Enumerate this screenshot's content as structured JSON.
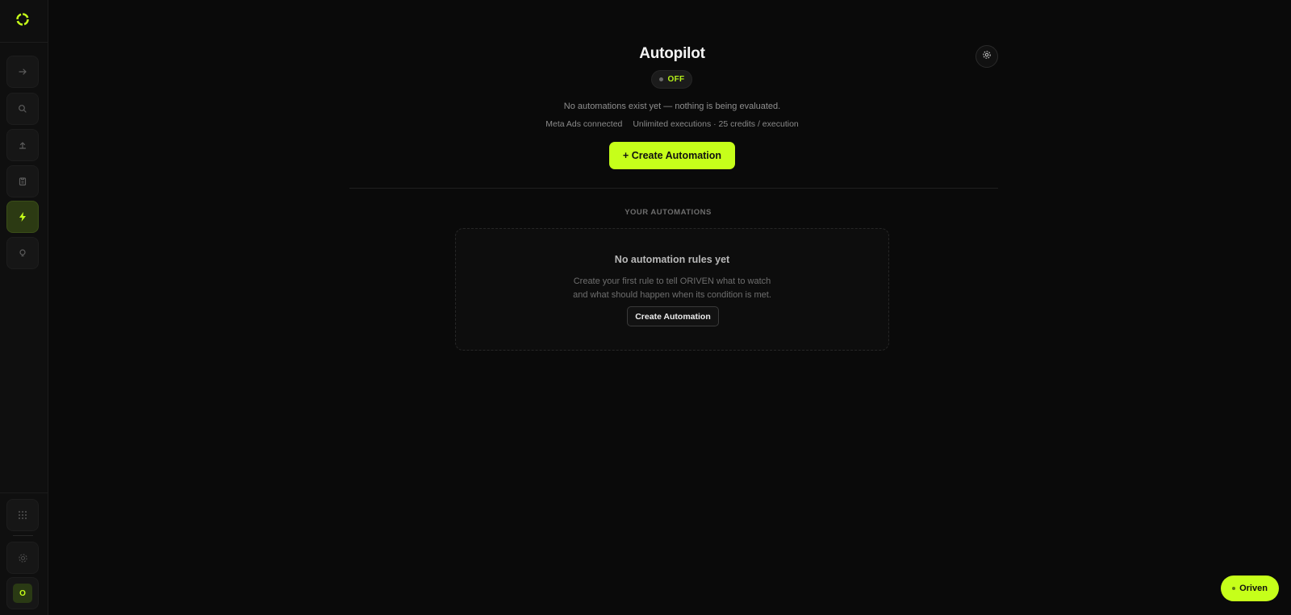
{
  "page": {
    "title": "Autopilot",
    "status": "OFF",
    "subtitle": "No automations exist yet — nothing is being evaluated.",
    "meta": {
      "connection": "Meta Ads connected",
      "executions": "Unlimited executions · 25 credits / execution"
    },
    "primary_action": "+ Create Automation",
    "section_label": "YOUR AUTOMATIONS",
    "empty_state": {
      "title": "No automation rules yet",
      "line1": "Create your first rule to tell ORIVEN what to watch",
      "line2": "and what should happen when its condition is met.",
      "action": "Create Automation"
    }
  },
  "sidebar": {
    "items": [
      {
        "icon": "arrow-right-icon"
      },
      {
        "icon": "search-icon"
      },
      {
        "icon": "upload-icon"
      },
      {
        "icon": "clipboard-icon"
      },
      {
        "icon": "lightning-icon",
        "active": true
      },
      {
        "icon": "lightbulb-icon"
      }
    ],
    "bottom": [
      {
        "icon": "grid-icon"
      },
      {
        "icon": "gear-icon"
      }
    ],
    "avatar_initial": "O"
  },
  "assistant": {
    "label": "Oriven"
  },
  "colors": {
    "accent": "#c6ff1a",
    "background": "#0a0a0a",
    "sidebar": "#0f0f0f",
    "active_item": "#2c3a13"
  }
}
